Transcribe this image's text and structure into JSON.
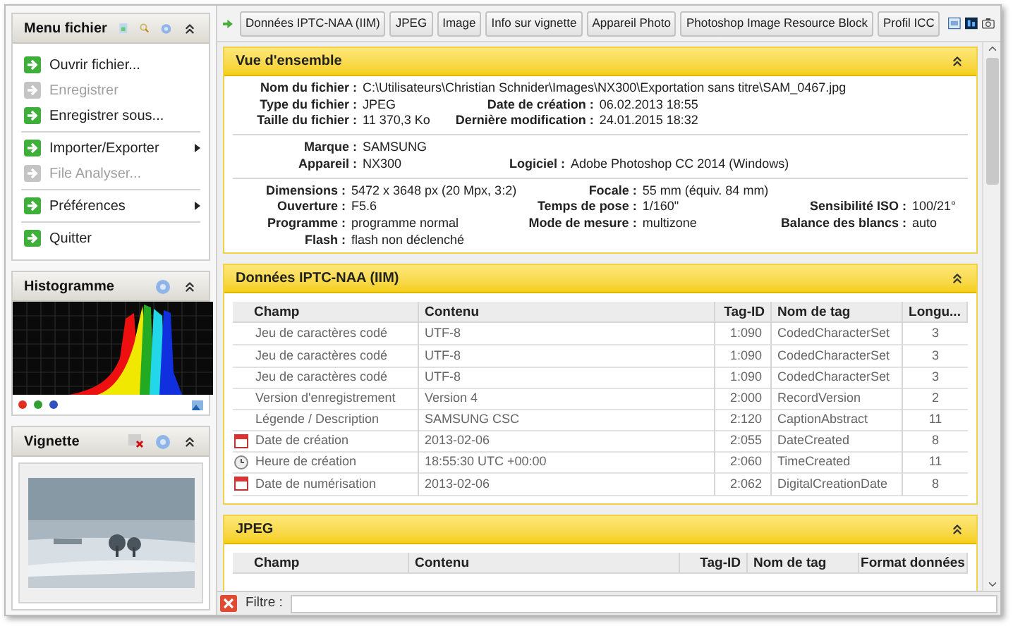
{
  "sidebar": {
    "file_menu": {
      "title": "Menu fichier",
      "groups": [
        [
          {
            "label": "Ouvrir fichier...",
            "disabled": false,
            "submenu": false
          },
          {
            "label": "Enregistrer",
            "disabled": true,
            "submenu": false
          },
          {
            "label": "Enregistrer sous...",
            "disabled": false,
            "submenu": false
          }
        ],
        [
          {
            "label": "Importer/Exporter",
            "disabled": false,
            "submenu": true
          },
          {
            "label": "File Analyser...",
            "disabled": true,
            "submenu": false
          }
        ],
        [
          {
            "label": "Préférences",
            "disabled": false,
            "submenu": true
          }
        ],
        [
          {
            "label": "Quitter",
            "disabled": false,
            "submenu": false
          }
        ]
      ]
    },
    "histogram": {
      "title": "Histogramme",
      "channels": [
        {
          "color": "#e03020"
        },
        {
          "color": "#30a030"
        },
        {
          "color": "#3050c0"
        }
      ]
    },
    "thumbnail": {
      "title": "Vignette"
    }
  },
  "toolbar": {
    "tabs": [
      "Données IPTC-NAA (IIM)",
      "JPEG",
      "Image",
      "Info sur vignette",
      "Appareil Photo",
      "Photoshop Image Resource Block",
      "Profil ICC"
    ]
  },
  "overview": {
    "title": "Vue d'ensemble",
    "groups": [
      [
        [
          {
            "label": "Nom du fichier :",
            "value": "C:\\Utilisateurs\\Christian Schnider\\Images\\NX300\\Exportation sans titre\\SAM_0467.jpg"
          }
        ],
        [
          {
            "label": "Type du fichier :",
            "value": "JPEG"
          },
          {
            "label": "Date de création :",
            "value": "06.02.2013 18:55"
          }
        ],
        [
          {
            "label": "Taille du fichier :",
            "value": "11 370,3 Ko"
          },
          {
            "label": "Dernière modification :",
            "value": "24.01.2015 18:32"
          }
        ]
      ],
      [
        [
          {
            "label": "Marque :",
            "value": "SAMSUNG"
          }
        ],
        [
          {
            "label": "Appareil :",
            "value": "NX300"
          },
          {
            "label": "Logiciel :",
            "value": "Adobe Photoshop CC 2014 (Windows)"
          }
        ]
      ],
      [
        [
          {
            "label": "Dimensions :",
            "value": "5472 x 3648 px (20 Mpx, 3:2)"
          },
          {
            "label": "Focale :",
            "value": "55 mm (équiv. 84 mm)"
          }
        ],
        [
          {
            "label": "Ouverture :",
            "value": "F5.6"
          },
          {
            "label": "Temps de pose :",
            "value": "1/160\""
          },
          {
            "label": "Sensibilité ISO :",
            "value": "100/21°"
          }
        ],
        [
          {
            "label": "Programme :",
            "value": "programme normal"
          },
          {
            "label": "Mode de mesure :",
            "value": "multizone"
          },
          {
            "label": "Balance des blancs :",
            "value": "auto"
          }
        ],
        [
          {
            "label": "Flash :",
            "value": "flash non déclenché"
          }
        ]
      ]
    ]
  },
  "iptc": {
    "title": "Données IPTC-NAA (IIM)",
    "columns": [
      "Champ",
      "Contenu",
      "Tag-ID",
      "Nom de tag",
      "Longu..."
    ],
    "rows": [
      {
        "kind": "plain",
        "cells": [
          "Jeu de caractères codé",
          "UTF-8",
          "1:090",
          "CodedCharacterSet",
          "3"
        ]
      },
      {
        "kind": "plain",
        "cells": [
          "Jeu de caractères codé",
          "UTF-8",
          "1:090",
          "CodedCharacterSet",
          "3"
        ]
      },
      {
        "kind": "plain",
        "cells": [
          "Jeu de caractères codé",
          "UTF-8",
          "1:090",
          "CodedCharacterSet",
          "3"
        ]
      },
      {
        "kind": "plain",
        "cells": [
          "Version d'enregistrement",
          "Version 4",
          "2:000",
          "RecordVersion",
          "2"
        ]
      },
      {
        "kind": "plain",
        "cells": [
          "Légende / Description",
          "SAMSUNG CSC",
          "2:120",
          "CaptionAbstract",
          "11"
        ]
      },
      {
        "kind": "date",
        "cells": [
          "Date de création",
          "2013-02-06",
          "2:055",
          "DateCreated",
          "8"
        ]
      },
      {
        "kind": "time",
        "cells": [
          "Heure de création",
          "18:55:30 UTC +00:00",
          "2:060",
          "TimeCreated",
          "11"
        ]
      },
      {
        "kind": "date",
        "cells": [
          "Date de numérisation",
          "2013-02-06",
          "2:062",
          "DigitalCreationDate",
          "8"
        ]
      }
    ]
  },
  "jpeg": {
    "title": "JPEG",
    "columns": [
      "Champ",
      "Contenu",
      "Tag-ID",
      "Nom de tag",
      "Format données"
    ]
  },
  "filter": {
    "label": "Filtre :"
  }
}
